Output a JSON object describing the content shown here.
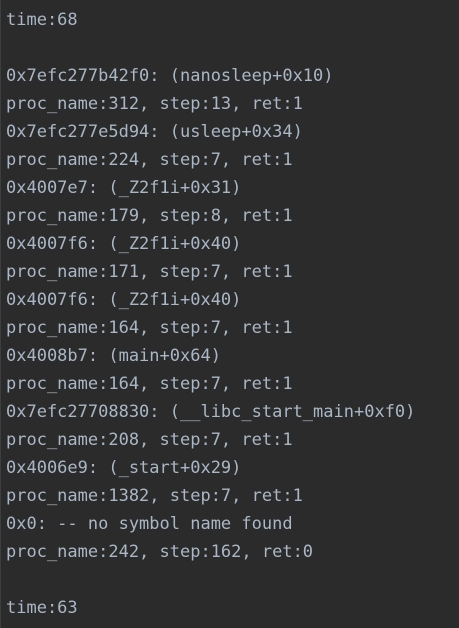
{
  "terminal": {
    "lines": [
      "time:68",
      "",
      "0x7efc277b42f0: (nanosleep+0x10)",
      "proc_name:312, step:13, ret:1",
      "0x7efc277e5d94: (usleep+0x34)",
      "proc_name:224, step:7, ret:1",
      "0x4007e7: (_Z2f1i+0x31)",
      "proc_name:179, step:8, ret:1",
      "0x4007f6: (_Z2f1i+0x40)",
      "proc_name:171, step:7, ret:1",
      "0x4007f6: (_Z2f1i+0x40)",
      "proc_name:164, step:7, ret:1",
      "0x4008b7: (main+0x64)",
      "proc_name:164, step:7, ret:1",
      "0x7efc27708830: (__libc_start_main+0xf0)",
      "proc_name:208, step:7, ret:1",
      "0x4006e9: (_start+0x29)",
      "proc_name:1382, step:7, ret:1",
      "0x0: -- no symbol name found",
      "proc_name:242, step:162, ret:0",
      "",
      "time:63"
    ]
  }
}
